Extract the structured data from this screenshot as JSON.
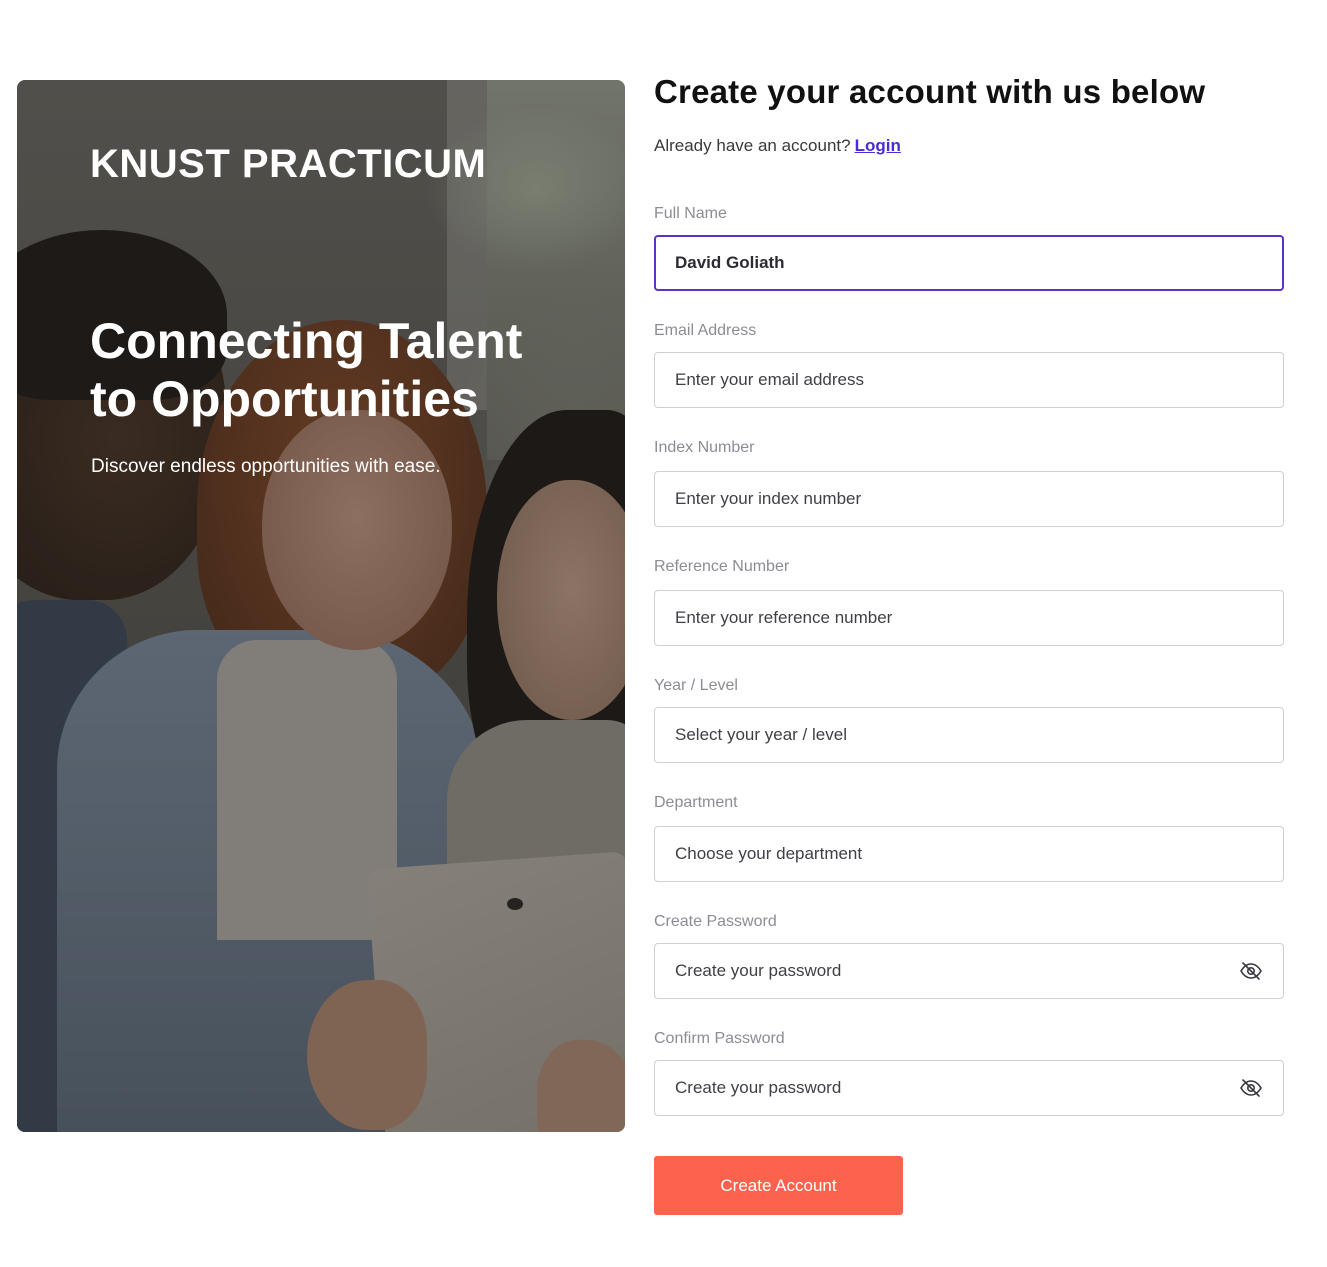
{
  "hero": {
    "brand": "KNUST PRACTICUM",
    "title_line1": "Connecting Talent",
    "title_line2": "to Opportunities",
    "subtitle": "Discover endless opportunities with ease."
  },
  "form": {
    "heading": "Create your account with us below",
    "login_prompt": "Already have an account?",
    "login_link": "Login",
    "fields": [
      {
        "label": "Full Name",
        "value": "David Goliath"
      },
      {
        "label": "Email Address",
        "placeholder": "Enter your email address"
      },
      {
        "label": "Index Number",
        "placeholder": "Enter your index number"
      },
      {
        "label": "Reference Number",
        "placeholder": "Enter your reference number"
      },
      {
        "label": "Year / Level",
        "placeholder": "Select your year / level"
      },
      {
        "label": "Department",
        "placeholder": "Choose your department"
      },
      {
        "label": "Create Password",
        "placeholder": "Create your password",
        "icon": "eye-off-icon"
      },
      {
        "label": "Confirm Password",
        "placeholder": "Create your password",
        "icon": "eye-off-icon"
      }
    ],
    "submit_label": "Create Account"
  },
  "colors": {
    "accent": "#fd624f",
    "link": "#4b2bd6",
    "focus_border": "#5b33c8"
  }
}
